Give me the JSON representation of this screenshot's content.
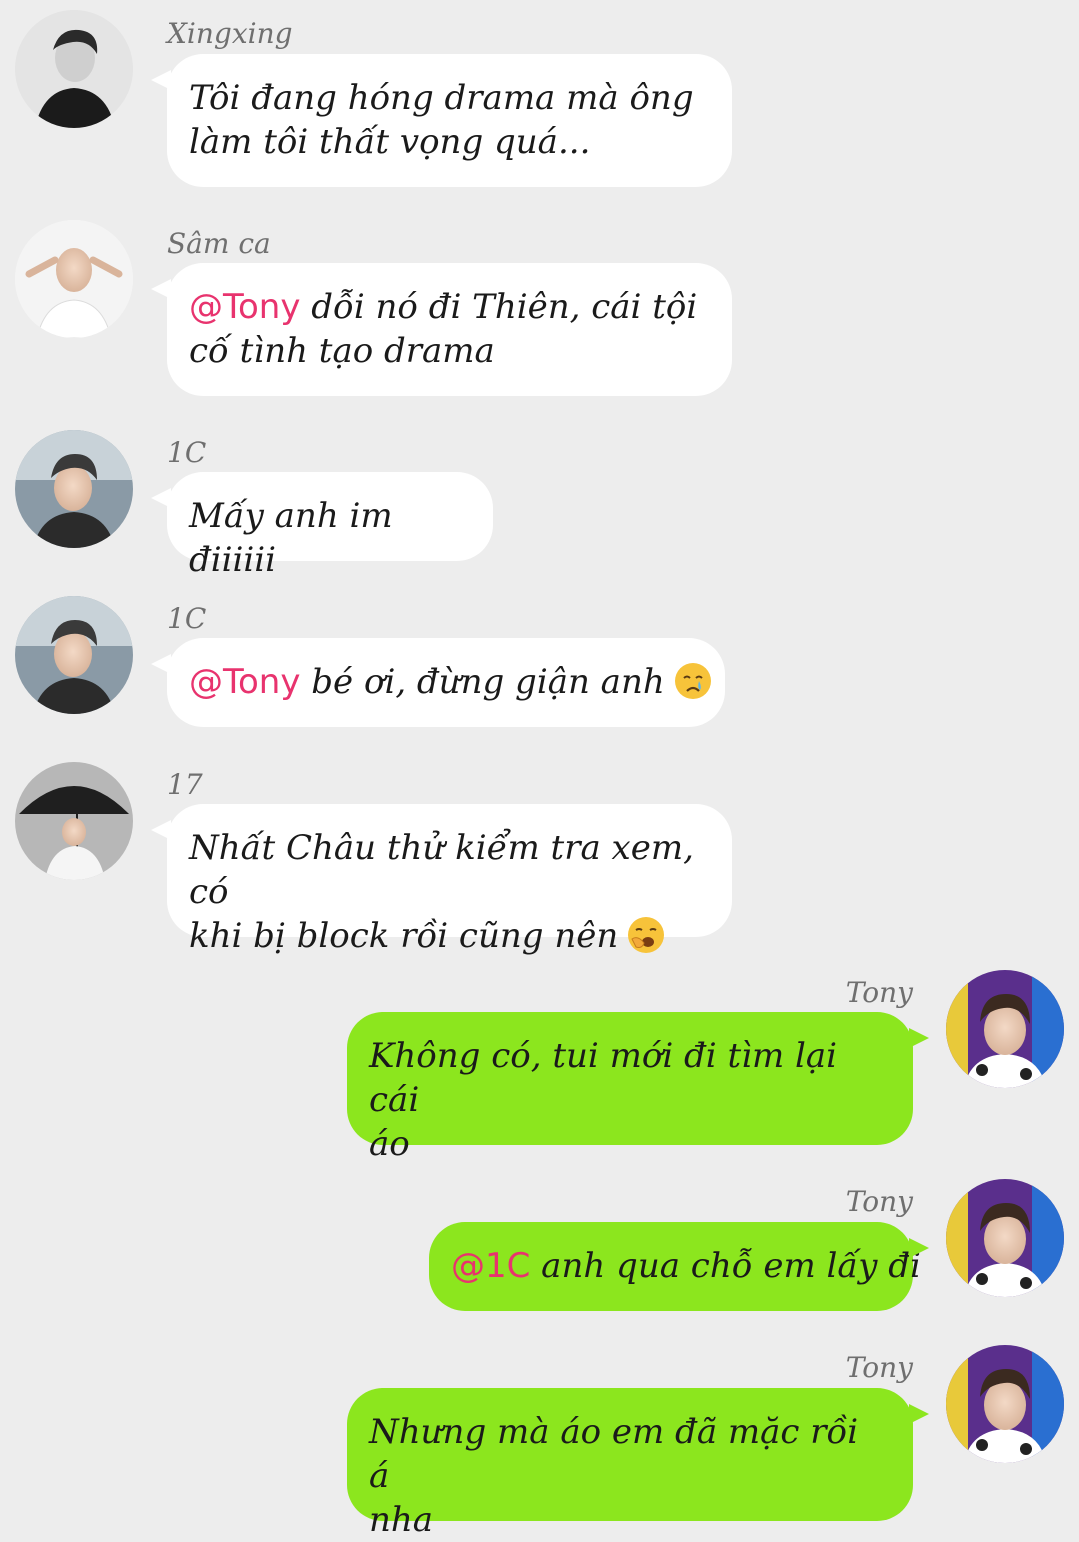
{
  "colors": {
    "background": "#ededed",
    "incoming_bubble": "#ffffff",
    "outgoing_bubble": "#8ce61e",
    "mention": "#e8336e",
    "sender_name": "#6f6f6f"
  },
  "messages": [
    {
      "sender": "Xingxing",
      "side": "left",
      "avatar": "avatar-xingxing",
      "line1": "Tôi đang hóng drama mà ông",
      "line2": "làm tôi thất vọng quá..."
    },
    {
      "sender": "Sâm ca",
      "side": "left",
      "avatar": "avatar-sam-ca",
      "mention": "@Tony",
      "line1": " dỗi nó đi Thiên, cái tội",
      "line2": "cố tình tạo drama"
    },
    {
      "sender": "1C",
      "side": "left",
      "avatar": "avatar-1c",
      "line1": "Mấy anh im điiiiii"
    },
    {
      "sender": "1C",
      "side": "left",
      "avatar": "avatar-1c",
      "mention": "@Tony",
      "line1": " bé ơi, đừng giận anh",
      "emoji": "crying-face-emoji"
    },
    {
      "sender": "17",
      "side": "left",
      "avatar": "avatar-17",
      "line1": "Nhất Châu thử kiểm tra xem, có",
      "line2": "khi bị block rồi cũng nên",
      "emoji": "yawning-face-emoji"
    },
    {
      "sender": "Tony",
      "side": "right",
      "avatar": "avatar-tony",
      "line1": "Không có, tui mới đi tìm lại cái",
      "line2": "áo"
    },
    {
      "sender": "Tony",
      "side": "right",
      "avatar": "avatar-tony",
      "mention": "@1C",
      "line1": " anh qua chỗ em lấy đi"
    },
    {
      "sender": "Tony",
      "side": "right",
      "avatar": "avatar-tony",
      "line1": "Nhưng mà áo em đã mặc rồi á",
      "line2": "nha"
    }
  ]
}
